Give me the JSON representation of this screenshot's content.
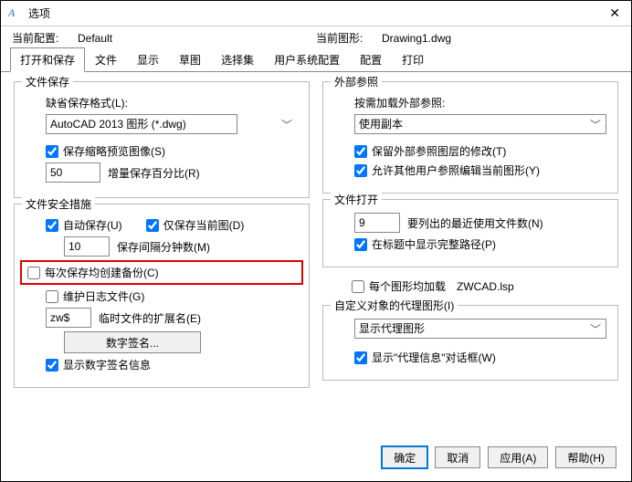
{
  "window": {
    "title": "选项"
  },
  "profile": {
    "current_label": "当前配置:",
    "current_value": "Default",
    "drawing_label": "当前图形:",
    "drawing_value": "Drawing1.dwg"
  },
  "tabs": {
    "t0": "打开和保存",
    "t1": "文件",
    "t2": "显示",
    "t3": "草图",
    "t4": "选择集",
    "t5": "用户系统配置",
    "t6": "配置",
    "t7": "打印"
  },
  "left": {
    "save": {
      "legend": "文件保存",
      "default_format_label": "缺省保存格式(L):",
      "format_select": "AutoCAD 2013 图形 (*.dwg)",
      "thumb_check": "保存缩略预览图像(S)",
      "percent_value": "50",
      "percent_label": "增量保存百分比(R)"
    },
    "safe": {
      "legend": "文件安全措施",
      "auto_save": "自动保存(U)",
      "only_current": "仅保存当前图(D)",
      "interval_value": "10",
      "interval_label": "保存间隔分钟数(M)",
      "backup": "每次保存均创建备份(C)",
      "log": "维护日志文件(G)",
      "ext_value": "zw$",
      "ext_label": "临时文件的扩展名(E)",
      "sig_button": "数字签名...",
      "show_sig": "显示数字签名信息"
    }
  },
  "right": {
    "xref": {
      "legend": "外部参照",
      "label": "按需加载外部参照:",
      "select": "使用副本",
      "keep_layer": "保留外部参照图层的修改(T)",
      "allow_edit": "允许其他用户参照编辑当前图形(Y)"
    },
    "open": {
      "legend": "文件打开",
      "recent_value": "9",
      "recent_label": "要列出的最近使用文件数(N)",
      "fullpath": "在标题中显示完整路径(P)"
    },
    "lsp_load": "每个图形均加载",
    "lsp_file": "ZWCAD.lsp",
    "proxy": {
      "legend": "自定义对象的代理图形(I)",
      "select": "显示代理图形",
      "show_dialog": "显示\"代理信息\"对话框(W)"
    }
  },
  "footer": {
    "ok": "确定",
    "cancel": "取消",
    "apply": "应用(A)",
    "help": "帮助(H)"
  }
}
